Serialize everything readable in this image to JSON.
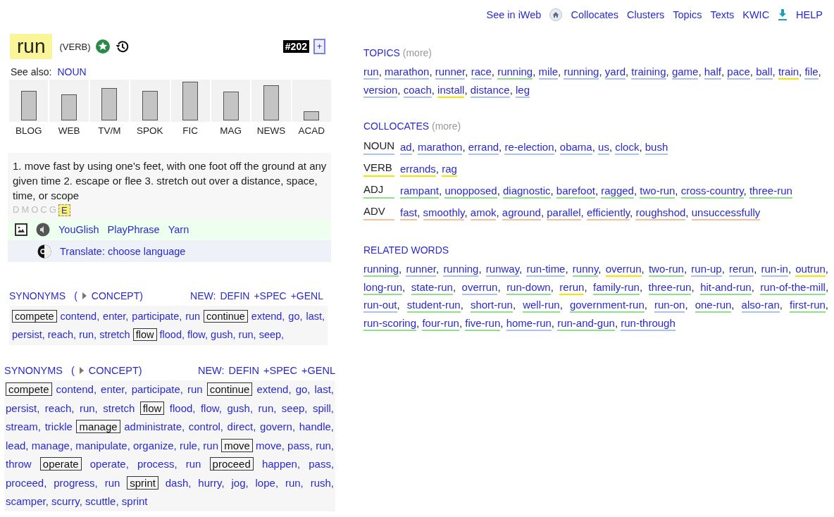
{
  "nav": {
    "links": [
      "See in iWeb",
      "Collocates",
      "Clusters",
      "Topics",
      "Texts",
      "KWIC",
      "HELP"
    ]
  },
  "word": {
    "headword": "run",
    "pos": "(VERB)",
    "rank": "#202",
    "plus": "+"
  },
  "see_also": {
    "label": "See also:",
    "link": "NOUN"
  },
  "genres": [
    {
      "label": "BLOG",
      "level": 0.72
    },
    {
      "label": "WEB",
      "level": 0.64
    },
    {
      "label": "TV/M",
      "level": 0.8
    },
    {
      "label": "SPOK",
      "level": 0.72
    },
    {
      "label": "FIC",
      "level": 0.95
    },
    {
      "label": "MAG",
      "level": 0.7
    },
    {
      "label": "NEWS",
      "level": 0.86
    },
    {
      "label": "ACAD",
      "level": 0.22
    }
  ],
  "definition": "1. move fast by using one's feet, with one foot off the ground at any given time 2. escape or flee 3. stretch out over a distance, space, time, or scope",
  "sources": [
    {
      "label": "D",
      "selected": false
    },
    {
      "label": "M",
      "selected": false
    },
    {
      "label": "O",
      "selected": false
    },
    {
      "label": "C",
      "selected": false
    },
    {
      "label": "G",
      "selected": false
    },
    {
      "label": "E",
      "selected": true
    }
  ],
  "media_links": [
    "YouGlish",
    "PlayPhrase",
    "Yarn"
  ],
  "translate": "Translate: choose language",
  "synonym_panels": [
    {
      "header": {
        "title": "SYNONYMS",
        "paren_open": "(",
        "concept": "CONCEPT)",
        "new": "NEW:",
        "links": [
          "DEFIN",
          "+SPEC",
          "+GENL"
        ]
      },
      "groups": [
        {
          "concept": "compete",
          "words": [
            "contend,",
            "enter,",
            "participate,",
            "run"
          ]
        },
        {
          "concept": "continue",
          "words": [
            "extend,",
            "go,",
            "last,",
            "persist,",
            "reach,",
            "run,",
            "stretch"
          ]
        },
        {
          "concept": "flow",
          "words": [
            "flood,",
            "flow,",
            "gush,",
            "run,",
            "seep,"
          ]
        }
      ]
    },
    {
      "header": {
        "title": "SYNONYMS",
        "paren_open": "(",
        "concept": "CONCEPT)",
        "new": "NEW:",
        "links": [
          "DEFIN",
          "+SPEC",
          "+GENL"
        ]
      },
      "groups": [
        {
          "concept": "compete",
          "words": [
            "contend,",
            "enter,",
            "participate,",
            "run"
          ]
        },
        {
          "concept": "continue",
          "words": [
            "extend,",
            "go,",
            "last,",
            "persist,",
            "reach,",
            "run,",
            "stretch"
          ]
        },
        {
          "concept": "flow",
          "words": [
            "flood,",
            "flow,",
            "gush,",
            "run,",
            "seep,",
            "spill,",
            "stream,",
            "trickle"
          ]
        },
        {
          "concept": "manage",
          "words": [
            "administrate,",
            "control,",
            "direct,",
            "govern,",
            "handle,",
            "lead,",
            "manage,",
            "manipulate,",
            "organize,",
            "rule,",
            "run"
          ]
        },
        {
          "concept": "move",
          "words": [
            "move,",
            "pass,",
            "run,",
            "throw"
          ]
        },
        {
          "concept": "operate",
          "words": [
            "operate,",
            "process,",
            "run"
          ]
        },
        {
          "concept": "proceed",
          "words": [
            "happen,",
            "pass,",
            "proceed,",
            "progress,",
            "run"
          ]
        },
        {
          "concept": "sprint",
          "words": [
            "dash,",
            "hurry,",
            "jog,",
            "lope,",
            "run,",
            "rush,",
            "scamper,",
            "scurry,",
            "scuttle,",
            "sprint"
          ]
        }
      ]
    }
  ],
  "topics": {
    "title": "TOPICS",
    "more": "(more)",
    "words": [
      {
        "text": "run",
        "sep": ",",
        "color": "#a9c4e8"
      },
      {
        "text": "marathon",
        "sep": ",",
        "color": "#a9c4e8"
      },
      {
        "text": "runner",
        "sep": ",",
        "color": "#a9c4e8"
      },
      {
        "text": "race",
        "sep": ",",
        "color": "#a9c4e8"
      },
      {
        "text": "running",
        "sep": ",",
        "color": "#8ee08e"
      },
      {
        "text": "mile",
        "sep": ",",
        "color": "#a9c4e8"
      },
      {
        "text": "running",
        "sep": ",",
        "color": "#a9c4e8"
      },
      {
        "text": "yard",
        "sep": ",",
        "color": "#a9c4e8"
      },
      {
        "text": "training",
        "sep": ",",
        "color": "#a9c4e8"
      },
      {
        "text": "game",
        "sep": ",",
        "color": "#a9c4e8"
      },
      {
        "text": "half",
        "sep": ",",
        "color": "#a9c4e8"
      },
      {
        "text": "pace",
        "sep": ",",
        "color": "#a9c4e8"
      },
      {
        "text": "ball",
        "sep": ",",
        "color": "#a9c4e8"
      },
      {
        "text": "train",
        "sep": ",",
        "color": "#f2e600"
      },
      {
        "text": "file",
        "sep": ",",
        "color": "#a9c4e8"
      },
      {
        "text": "version",
        "sep": ",",
        "color": "#a9c4e8"
      },
      {
        "text": "coach",
        "sep": ",",
        "color": "#a9c4e8"
      },
      {
        "text": "install",
        "sep": ",",
        "color": "#f2e600"
      },
      {
        "text": "distance",
        "sep": ",",
        "color": "#a9c4e8"
      },
      {
        "text": "leg",
        "color": "#a9c4e8"
      }
    ]
  },
  "collocates": {
    "title": "COLLOCATES",
    "more": "(more)",
    "rows": [
      {
        "pos": "NOUN",
        "color": "#a9c4e8",
        "words": [
          {
            "text": "ad",
            "sep": ","
          },
          {
            "text": "marathon",
            "sep": ","
          },
          {
            "text": "errand",
            "sep": ","
          },
          {
            "text": "re-election",
            "sep": ","
          },
          {
            "text": "obama",
            "sep": ","
          },
          {
            "text": "us",
            "sep": ","
          },
          {
            "text": "clock",
            "sep": ","
          },
          {
            "text": "bush"
          }
        ]
      },
      {
        "pos": "VERB",
        "color": "#f2e600",
        "words": [
          {
            "text": "errands",
            "sep": ","
          },
          {
            "text": "rag"
          }
        ]
      },
      {
        "pos": "ADJ",
        "color": "#8ee08e",
        "words": [
          {
            "text": "rampant",
            "sep": ","
          },
          {
            "text": "unopposed",
            "sep": ","
          },
          {
            "text": "diagnostic",
            "sep": ","
          },
          {
            "text": "barefoot",
            "sep": ","
          },
          {
            "text": "ragged",
            "sep": ","
          },
          {
            "text": "two-run",
            "sep": ","
          },
          {
            "text": "cross-country",
            "sep": ","
          },
          {
            "text": "three-run"
          }
        ]
      },
      {
        "pos": "ADV",
        "color": "#f5c09a",
        "words": [
          {
            "text": "fast",
            "sep": ","
          },
          {
            "text": "smoothly",
            "sep": ","
          },
          {
            "text": "amok",
            "sep": ","
          },
          {
            "text": "aground",
            "sep": ","
          },
          {
            "text": "parallel",
            "sep": ","
          },
          {
            "text": "efficiently",
            "sep": ","
          },
          {
            "text": "roughshod",
            "sep": ","
          },
          {
            "text": "unsuccessfully"
          }
        ]
      }
    ]
  },
  "related": {
    "title": "RELATED WORDS",
    "words": [
      {
        "text": "running",
        "sep": ",",
        "color": "#8ee08e"
      },
      {
        "text": "runner",
        "sep": ",",
        "color": "#a9c4e8"
      },
      {
        "text": "running",
        "sep": ",",
        "color": "#a9c4e8"
      },
      {
        "text": "runway",
        "sep": ",",
        "color": "#a9c4e8"
      },
      {
        "text": "run-time",
        "sep": ",",
        "color": "#a9c4e8"
      },
      {
        "text": "runny",
        "sep": ",",
        "color": "#8ee08e"
      },
      {
        "text": "overrun",
        "sep": ",",
        "color": "#f2e600"
      },
      {
        "text": "two-run",
        "sep": ",",
        "color": "#8ee08e"
      },
      {
        "text": "run-up",
        "sep": ",",
        "color": "#a9c4e8"
      },
      {
        "text": "rerun",
        "sep": ",",
        "color": "#a9c4e8"
      },
      {
        "text": "run-in",
        "sep": ",",
        "color": "#a9c4e8"
      },
      {
        "text": "outrun",
        "sep": ",",
        "color": "#f2e600"
      },
      {
        "text": "long-run",
        "sep": ",",
        "color": "#8ee08e"
      },
      {
        "text": "state-run",
        "sep": ",",
        "color": "#8ee08e"
      },
      {
        "text": "overrun",
        "sep": ",",
        "color": "#a9c4e8"
      },
      {
        "text": "run-down",
        "sep": ",",
        "color": "#8ee08e"
      },
      {
        "text": "rerun",
        "sep": ",",
        "color": "#f2e600"
      },
      {
        "text": "family-run",
        "sep": ",",
        "color": "#8ee08e"
      },
      {
        "text": "three-run",
        "sep": ",",
        "color": "#8ee08e"
      },
      {
        "text": "hit-and-run",
        "sep": ",",
        "color": "#8ee08e"
      },
      {
        "text": "run-of-the-mill",
        "sep": ",",
        "color": "#8ee08e"
      },
      {
        "text": "run-out",
        "sep": ",",
        "color": "#a9c4e8"
      },
      {
        "text": "student-run",
        "sep": ",",
        "color": "#8ee08e"
      },
      {
        "text": "short-run",
        "sep": ",",
        "color": "#8ee08e"
      },
      {
        "text": "well-run",
        "sep": ",",
        "color": "#8ee08e"
      },
      {
        "text": "government-run",
        "sep": ",",
        "color": "#8ee08e"
      },
      {
        "text": "run-on",
        "sep": ",",
        "color": "#a9c4e8"
      },
      {
        "text": "one-run",
        "sep": ",",
        "color": "#8ee08e"
      },
      {
        "text": "also-ran",
        "sep": ",",
        "color": "#a9c4e8"
      },
      {
        "text": "first-run",
        "sep": ",",
        "color": "#8ee08e"
      },
      {
        "text": "run-scoring",
        "sep": ",",
        "color": "#8ee08e"
      },
      {
        "text": "four-run",
        "sep": ",",
        "color": "#8ee08e"
      },
      {
        "text": "five-run",
        "sep": ",",
        "color": "#8ee08e"
      },
      {
        "text": "home-run",
        "sep": ",",
        "color": "#a9c4e8"
      },
      {
        "text": "run-and-gun",
        "sep": ",",
        "color": "#8ee08e"
      },
      {
        "text": "run-through",
        "color": "#a9c4e8"
      }
    ]
  }
}
